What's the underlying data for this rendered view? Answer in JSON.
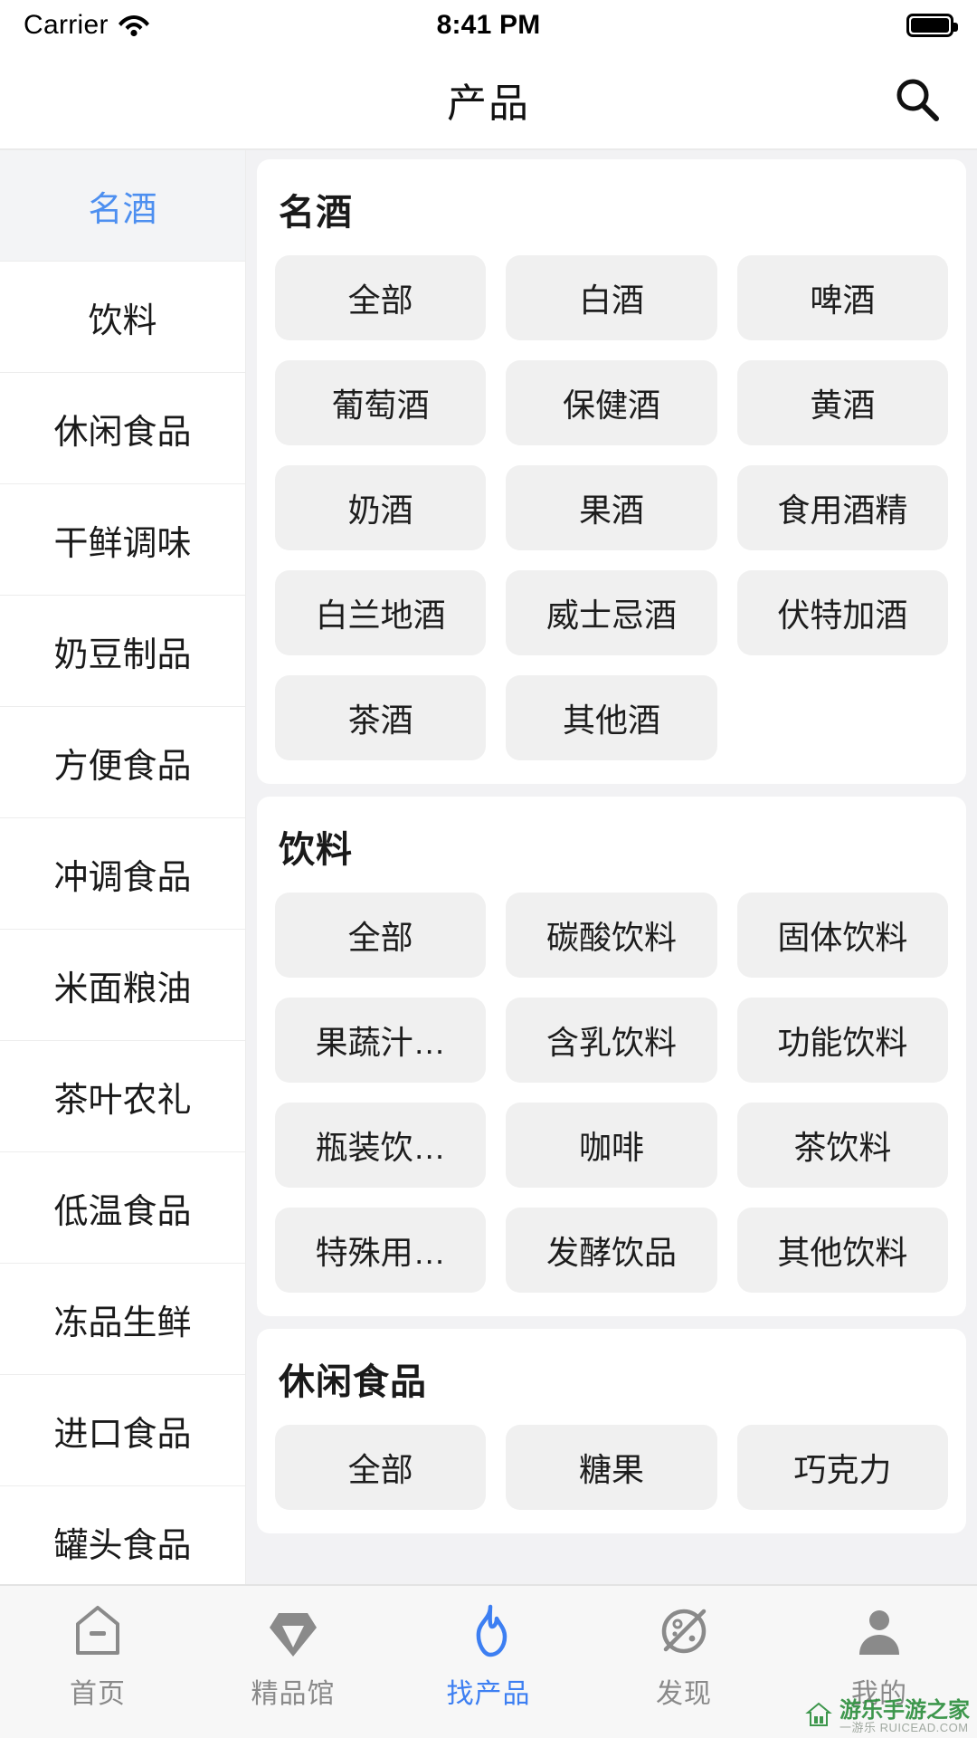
{
  "statusbar": {
    "carrier": "Carrier",
    "wifi_icon": "wifi-icon",
    "time": "8:41 PM",
    "battery_icon": "battery-icon"
  },
  "navbar": {
    "title": "产品",
    "search_icon": "search-icon"
  },
  "sidebar": {
    "active_index": 0,
    "items": [
      {
        "label": "名酒"
      },
      {
        "label": "饮料"
      },
      {
        "label": "休闲食品"
      },
      {
        "label": "干鲜调味"
      },
      {
        "label": "奶豆制品"
      },
      {
        "label": "方便食品"
      },
      {
        "label": "冲调食品"
      },
      {
        "label": "米面粮油"
      },
      {
        "label": "茶叶农礼"
      },
      {
        "label": "低温食品"
      },
      {
        "label": "冻品生鲜"
      },
      {
        "label": "进口食品"
      },
      {
        "label": "罐头食品"
      }
    ]
  },
  "main": {
    "sections": [
      {
        "title": "名酒",
        "tags": [
          "全部",
          "白酒",
          "啤酒",
          "葡萄酒",
          "保健酒",
          "黄酒",
          "奶酒",
          "果酒",
          "食用酒精",
          "白兰地酒",
          "威士忌酒",
          "伏特加酒",
          "茶酒",
          "其他酒"
        ]
      },
      {
        "title": "饮料",
        "tags": [
          "全部",
          "碳酸饮料",
          "固体饮料",
          "果蔬汁…",
          "含乳饮料",
          "功能饮料",
          "瓶装饮…",
          "咖啡",
          "茶饮料",
          "特殊用…",
          "发酵饮品",
          "其他饮料"
        ]
      },
      {
        "title": "休闲食品",
        "tags": [
          "全部",
          "糖果",
          "巧克力"
        ]
      }
    ]
  },
  "tabbar": {
    "active_index": 2,
    "items": [
      {
        "label": "首页",
        "icon": "home-icon"
      },
      {
        "label": "精品馆",
        "icon": "diamond-icon"
      },
      {
        "label": "找产品",
        "icon": "flame-icon"
      },
      {
        "label": "发现",
        "icon": "planet-icon"
      },
      {
        "label": "我的",
        "icon": "person-icon"
      }
    ]
  },
  "watermark": {
    "main": "游乐手游之家",
    "sub": "一游乐 RUICEAD.COM"
  },
  "colors": {
    "accent": "#3d7ff2",
    "sidebar_active_text": "#4d8ff0",
    "tag_bg": "#f0f0f0",
    "page_bg": "#f2f2f4"
  }
}
